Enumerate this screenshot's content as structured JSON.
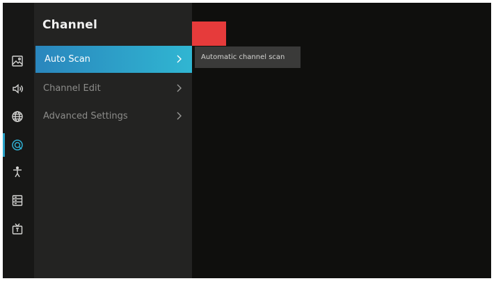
{
  "sidebar": {
    "icons": [
      {
        "name": "picture-icon"
      },
      {
        "name": "sound-icon"
      },
      {
        "name": "network-globe-icon"
      },
      {
        "name": "channel-icon",
        "active": true
      },
      {
        "name": "accessibility-icon"
      },
      {
        "name": "system-icon"
      },
      {
        "name": "tv-icon"
      }
    ]
  },
  "menu": {
    "title": "Channel",
    "items": [
      {
        "label": "Auto Scan",
        "active": true
      },
      {
        "label": "Channel Edit"
      },
      {
        "label": "Advanced Settings"
      }
    ]
  },
  "detail": {
    "description": "Automatic channel scan"
  },
  "colors": {
    "accent": "#2a9fd0",
    "highlight_red": "#e63b3b",
    "background": "#0f0f0d",
    "panel": "#232322"
  }
}
